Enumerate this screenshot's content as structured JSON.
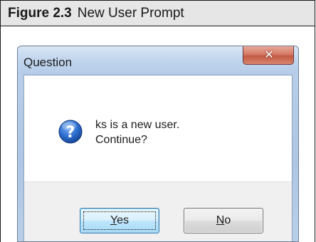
{
  "figure": {
    "number": "Figure 2.3",
    "title": "New User Prompt"
  },
  "dialog": {
    "title": "Question",
    "close_icon": "close-icon",
    "message_icon": "question-icon",
    "message_line_1": "ks is a new user.",
    "message_line_2": "Continue?",
    "buttons": {
      "yes_mnemonic": "Y",
      "yes_rest": "es",
      "no_mnemonic": "N",
      "no_rest": "o"
    }
  },
  "colors": {
    "caption_background": "#e6e6e6",
    "question_icon_blue": "#1f5fbf",
    "close_button_red": "#c25a44",
    "default_button_border": "#3c7fb1"
  }
}
